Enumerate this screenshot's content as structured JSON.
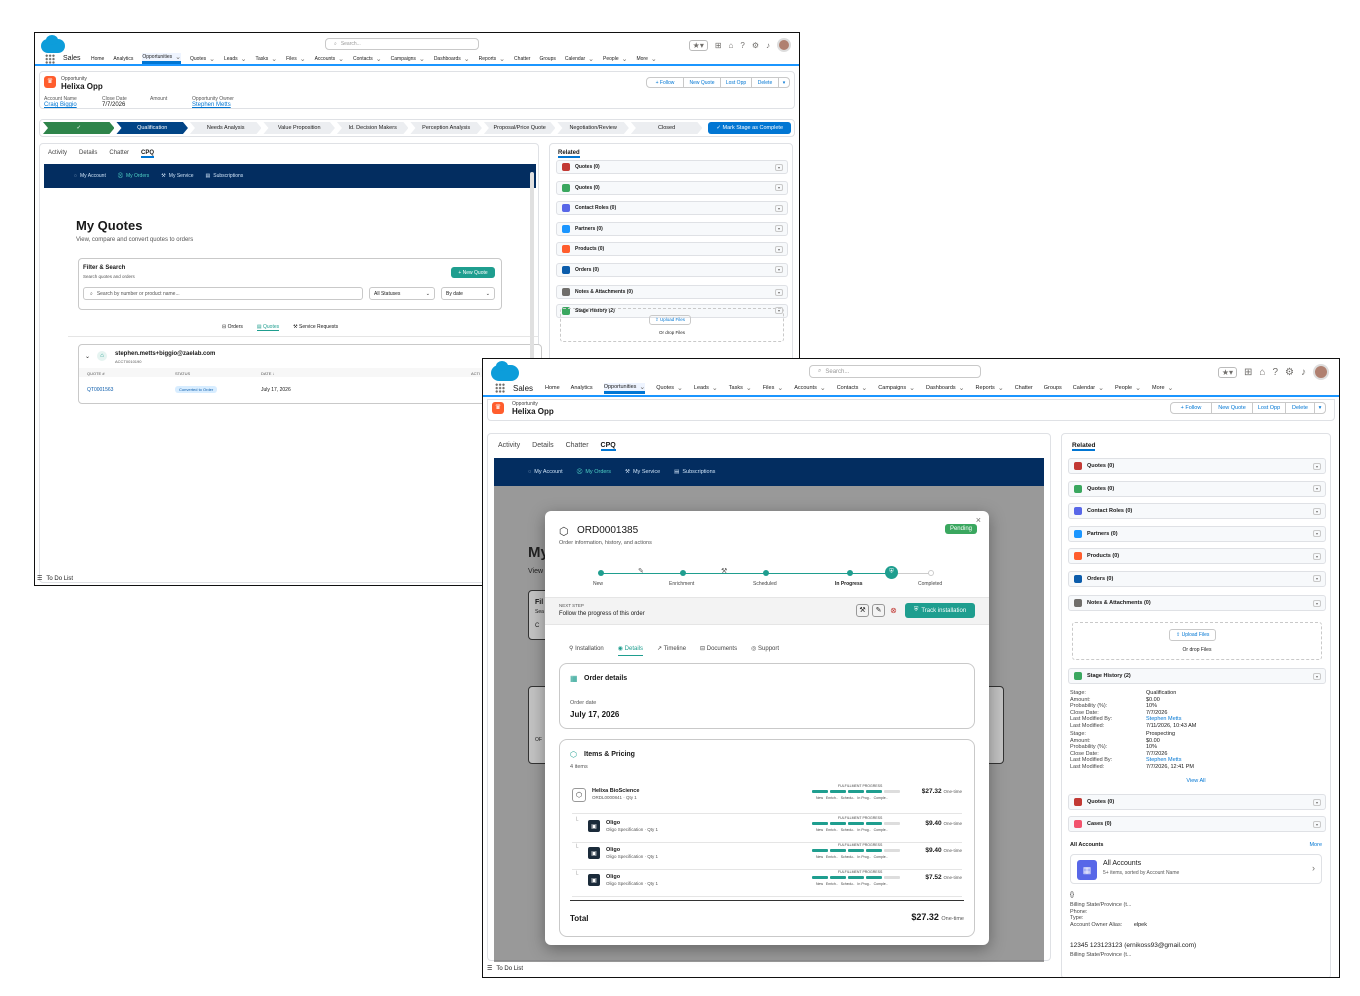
{
  "w1": {
    "search_placeholder": "Search...",
    "app": "Sales",
    "nav": [
      "Home",
      "Analytics",
      "Opportunities",
      "Quotes",
      "Leads",
      "Tasks",
      "Files",
      "Accounts",
      "Contacts",
      "Campaigns",
      "Dashboards",
      "Reports",
      "Chatter",
      "Groups",
      "Calendar",
      "People",
      "More"
    ],
    "object_type": "Opportunity",
    "record_name": "Helixa Opp",
    "buttons": [
      "+ Follow",
      "New Quote",
      "Lost Opp",
      "Delete"
    ],
    "fields": [
      {
        "label": "Account Name",
        "value": "Craig Biggio"
      },
      {
        "label": "Close Date",
        "value": "7/7/2026"
      },
      {
        "label": "Amount",
        "value": ""
      },
      {
        "label": "Opportunity Owner",
        "value": "Stephen Metts"
      }
    ],
    "stages": [
      "Qualification",
      "Needs Analysis",
      "Value Proposition",
      "Id. Decision Makers",
      "Perception Analysis",
      "Proposal/Price Quote",
      "Negotiation/Review",
      "Closed"
    ],
    "mark_complete": "✓ Mark Stage as Complete",
    "tabs": [
      "Activity",
      "Details",
      "Chatter",
      "CPQ"
    ],
    "cpq_nav": [
      "My Account",
      "My Orders",
      "My Service",
      "Subscriptions"
    ],
    "quotes_title": "My Quotes",
    "quotes_sub": "View, compare and convert quotes to orders",
    "filter_title": "Filter & Search",
    "filter_sub": "Search quotes and orders",
    "new_quote": "+ New Quote",
    "search_ph": "Search by number or product name...",
    "status_sel": "All Statuses",
    "date_sel": "By date",
    "subtabs": [
      "Orders",
      "Quotes",
      "Service Requests"
    ],
    "account_email": "stephen.metts+biggio@zaelab.com",
    "account_no": "ACCT0010190",
    "cols": [
      "QUOTE #",
      "STATUS",
      "DATE ↓",
      "ACTI"
    ],
    "row": {
      "quote": "QT0001563",
      "status": "Converted to Order",
      "date": "July 17, 2026"
    },
    "related_title": "Related",
    "related": [
      "Quotes (0)",
      "Quotes (0)",
      "Contact Roles (0)",
      "Partners (0)",
      "Products (0)",
      "Orders (0)",
      "Notes & Attachments (0)",
      "Stage History (2)"
    ],
    "upload": "Upload Files",
    "drop": "Or drop Files",
    "todo": "To Do List"
  },
  "w2": {
    "search_placeholder": "Search...",
    "app": "Sales",
    "nav": [
      "Home",
      "Analytics",
      "Opportunities",
      "Quotes",
      "Leads",
      "Tasks",
      "Files",
      "Accounts",
      "Contacts",
      "Campaigns",
      "Dashboards",
      "Reports",
      "Chatter",
      "Groups",
      "Calendar",
      "People",
      "More"
    ],
    "object_type": "Opportunity",
    "record_name": "Helixa Opp",
    "buttons": [
      "+ Follow",
      "New Quote",
      "Lost Opp",
      "Delete"
    ],
    "tabs": [
      "Activity",
      "Details",
      "Chatter",
      "CPQ"
    ],
    "cpq_nav": [
      "My Account",
      "My Orders",
      "My Service",
      "Subscriptions"
    ],
    "bg_letters": {
      "a": "My",
      "b": "View",
      "c": "Fil",
      "d": "Sea",
      "e": "C",
      "f": "OF"
    },
    "modal": {
      "order_no": "ORD0001385",
      "subtitle": "Order information, history, and actions",
      "status": "Pending",
      "steps": [
        "New",
        "Enrichment",
        "Scheduled",
        "In Progress",
        "Completed"
      ],
      "next_label": "NEXT STEP",
      "next_text": "Follow the progress of this order",
      "track": "Track installation",
      "tabs": [
        "Installation",
        "Details",
        "Timeline",
        "Documents",
        "Support"
      ],
      "details_title": "Order details",
      "order_date_label": "Order date",
      "order_date": "July 17, 2026",
      "items_title": "Items & Pricing",
      "items_count": "4 items",
      "progress_label": "FULFILLMENT PROGRESS",
      "progress_steps": "New   Enrich..   Schedu..   In Prog..   Comple..",
      "items": [
        {
          "name": "Helixa BioScience",
          "sub": "ORDL0000841 · Qty 1",
          "price": "$27.32",
          "term": "One-time"
        },
        {
          "name": "Oligo",
          "sub": "Oligo Specification · Qty 1",
          "price": "$9.40",
          "term": "One-time"
        },
        {
          "name": "Oligo",
          "sub": "Oligo Specification · Qty 1",
          "price": "$9.40",
          "term": "One-time"
        },
        {
          "name": "Oligo",
          "sub": "Oligo Specification · Qty 1",
          "price": "$7.52",
          "term": "One-time"
        }
      ],
      "total_label": "Total",
      "total": "$27.32",
      "total_term": "One-time",
      "close": "×"
    },
    "related_title": "Related",
    "related": [
      "Quotes (0)",
      "Quotes (0)",
      "Contact Roles (0)",
      "Partners (0)",
      "Products (0)",
      "Orders (0)",
      "Notes & Attachments (0)"
    ],
    "upload": "Upload Files",
    "drop": "Or drop Files",
    "stage_history": "Stage History (2)",
    "sh1": {
      "labels": "Stage:\nAmount:\nProbability (%):\nClose Date:\nLast Modified By:\nLast Modified:",
      "stage": "Qualification",
      "amount": "$0.00",
      "prob": "10%",
      "close": "7/7/2026",
      "by": "Stephen Metts",
      "mod": "7/11/2026, 10:43 AM"
    },
    "sh2": {
      "stage": "Prospecting",
      "amount": "$0.00",
      "prob": "10%",
      "close": "7/7/2026",
      "by": "Stephen Metts",
      "mod": "7/7/2026, 12:41 PM"
    },
    "view_all": "View All",
    "related2": [
      "Quotes (0)",
      "Cases (0)"
    ],
    "all_accounts": "All Accounts",
    "more": "More",
    "acc_title": "All Accounts",
    "acc_sub": "5+ items, sorted by Account Name",
    "acc_brace": "{}",
    "acc1": {
      "l1": "Billing State/Province (t...",
      "l2": "Phone:",
      "l3": "Type:",
      "l4": "Account Owner Alias:",
      "alias": "elpek"
    },
    "acc2": {
      "name": "12345 123123123 (ernikoss93@gmail.com)",
      "l1": "Billing State/Province (t..."
    },
    "todo": "To Do List"
  },
  "colors": {
    "brand": "#0176d3",
    "teal": "#1f9e8f",
    "navy": "#032d60",
    "opp": "#ff5d2d",
    "green": "#2e844a"
  }
}
